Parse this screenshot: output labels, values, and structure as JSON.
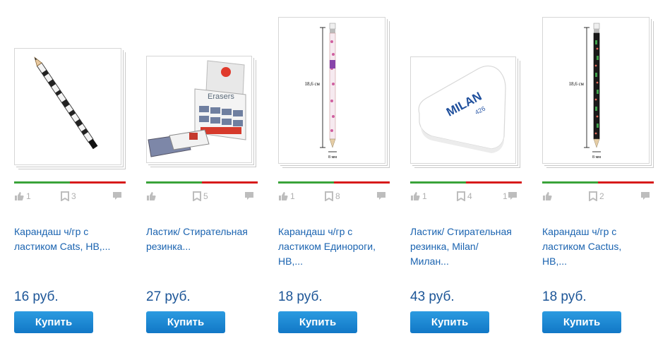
{
  "currency": "руб.",
  "buy_label": "Купить",
  "products": [
    {
      "title": "Карандаш ч/гр с ластиком Cats, НВ,...",
      "price": "16 руб.",
      "rating_positive": 0.5,
      "likes": "1",
      "bookmarks": "3",
      "comments": ""
    },
    {
      "title": "Ластик/ Стирательная резинка...",
      "price": "27 руб.",
      "rating_positive": 0.5,
      "likes": "",
      "bookmarks": "5",
      "comments": ""
    },
    {
      "title": "Карандаш ч/гр с ластиком Единороги, НВ,...",
      "price": "18 руб.",
      "rating_positive": 0.5,
      "likes": "1",
      "bookmarks": "8",
      "comments": ""
    },
    {
      "title": "Ластик/ Стирательная резинка, Milan/ Милан...",
      "price": "43 руб.",
      "rating_positive": 0.5,
      "likes": "1",
      "bookmarks": "4",
      "comments": "1"
    },
    {
      "title": "Карандаш ч/гр с ластиком Cactus, НВ,...",
      "price": "18 руб.",
      "rating_positive": 0.5,
      "likes": "",
      "bookmarks": "2",
      "comments": ""
    }
  ],
  "image_text": {
    "eraser_box_brand": "Erasers",
    "eraser_brand": "MILAN",
    "eraser_model": "426",
    "pencil_length": "18,6 см",
    "pencil_width": "8 мм"
  },
  "colors": {
    "link": "#1a63b0",
    "price": "#1c5597",
    "rating_positive": "#3aa33a",
    "rating_negative": "#d71a1a",
    "button": "#1a86d2"
  }
}
